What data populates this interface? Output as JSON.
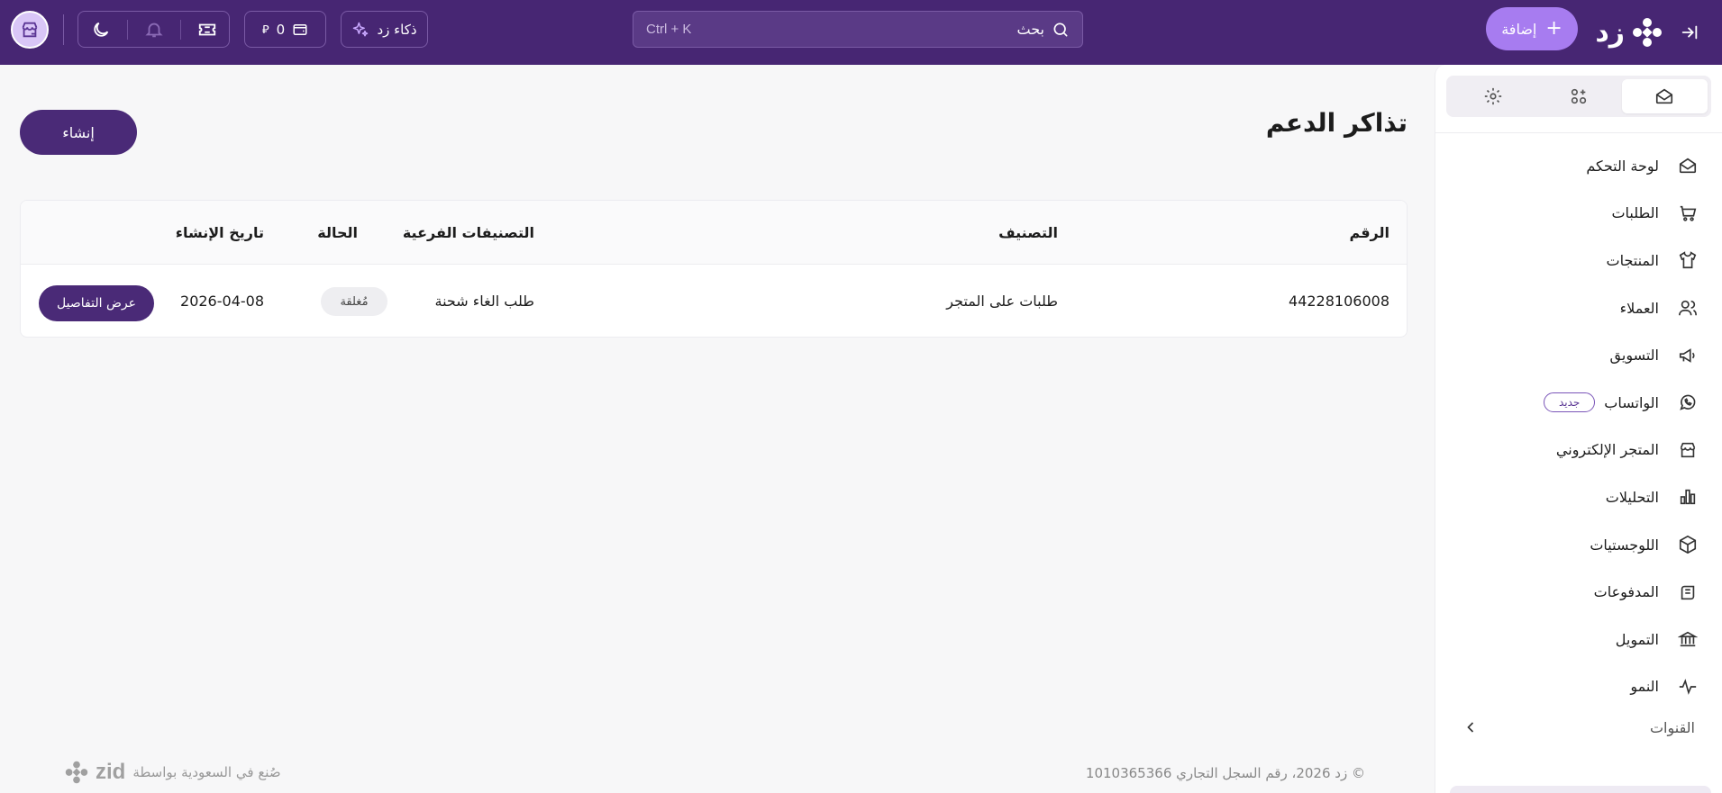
{
  "topbar": {
    "brand": "زد",
    "add_label": "إضافة",
    "add_plus": "+",
    "search_label": "بحث",
    "search_shortcut": "Ctrl + K",
    "ai_label": "ذكاء زد",
    "wallet_amount": "0",
    "currency_symbol": "⃁",
    "icons": [
      "collapse-icon",
      "zid-logo-icon",
      "plus-icon",
      "search-icon",
      "sparkles-icon",
      "wallet-icon",
      "ticket-icon",
      "bell-icon",
      "moon-icon",
      "store-icon"
    ]
  },
  "sidebar": {
    "tabs": [
      "home-icon",
      "apps-icon",
      "settings-icon"
    ],
    "items": [
      {
        "label": "لوحة التحكم",
        "icon": "dashboard-icon"
      },
      {
        "label": "الطلبات",
        "icon": "cart-icon"
      },
      {
        "label": "المنتجات",
        "icon": "shirt-icon"
      },
      {
        "label": "العملاء",
        "icon": "users-icon"
      },
      {
        "label": "التسويق",
        "icon": "megaphone-icon"
      },
      {
        "label": "الواتساب",
        "icon": "whatsapp-icon",
        "badge": "جديد"
      },
      {
        "label": "المتجر الإلكتروني",
        "icon": "storefront-icon"
      },
      {
        "label": "التحليلات",
        "icon": "chart-icon"
      },
      {
        "label": "اللوجستيات",
        "icon": "box-icon"
      },
      {
        "label": "المدفوعات",
        "icon": "payments-icon"
      },
      {
        "label": "التمويل",
        "icon": "bank-icon"
      },
      {
        "label": "النمو",
        "icon": "growth-icon"
      }
    ],
    "channels_label": "القنوات"
  },
  "main": {
    "title": "تذاكر الدعم",
    "create_label": "إنشاء",
    "table": {
      "headers": {
        "number": "الرقم",
        "category": "التصنيف",
        "subcategories": "التصنيفات الفرعية",
        "status": "الحالة",
        "created_at": "تاريخ الإنشاء"
      },
      "rows": [
        {
          "number": "44228106008",
          "category": "طلبات على المتجر",
          "subcategory": "طلب الغاء شحنة",
          "status": "مُغلقة",
          "created_at": "2026-04-08",
          "action": "عرض التفاصيل"
        }
      ]
    }
  },
  "footer": {
    "copyright": "© زد 2026، رقم السجل التجاري 1010365366",
    "made_in": "صُنع في السعودية بواسطة",
    "brand_word": "zid"
  },
  "colors": {
    "topbar": "#472673",
    "accent": "#a77cf0",
    "primary_button": "#4a2a77",
    "background": "#f7f7f8"
  }
}
